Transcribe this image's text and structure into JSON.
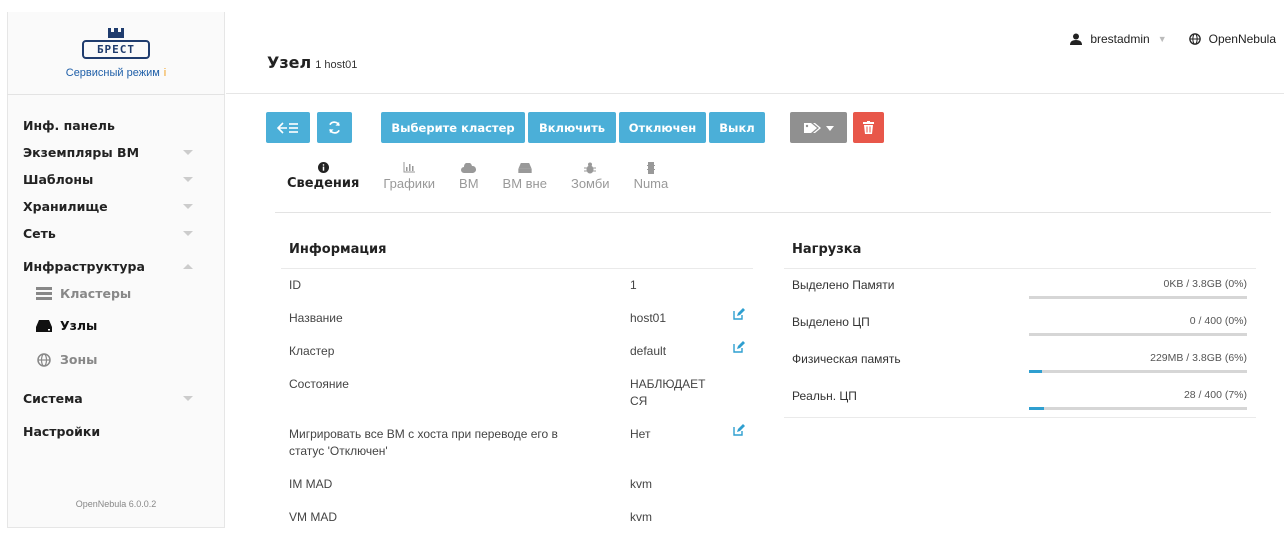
{
  "sidebar": {
    "logo_text": "БРЕСТ",
    "mode": "Сервисный режим",
    "mode_info": "i",
    "menu": [
      {
        "label": "Инф. панель"
      },
      {
        "label": "Экземпляры ВМ"
      },
      {
        "label": "Шаблоны"
      },
      {
        "label": "Хранилище"
      },
      {
        "label": "Сеть"
      },
      {
        "label": "Инфраструктура"
      },
      {
        "label": "Система"
      },
      {
        "label": "Настройки"
      }
    ],
    "submenu": [
      {
        "label": "Кластеры"
      },
      {
        "label": "Узлы"
      },
      {
        "label": "Зоны"
      }
    ],
    "version": "OpenNebula 6.0.0.2"
  },
  "header": {
    "title": "Узел",
    "subtitle": "1 host01",
    "user": "brestadmin",
    "zone": "OpenNebula"
  },
  "toolbar": {
    "choose_cluster": "Выберите кластер",
    "enable": "Включить",
    "disable": "Отключен",
    "off": "Выкл"
  },
  "tabs": [
    {
      "label": "Сведения"
    },
    {
      "label": "Графики"
    },
    {
      "label": "ВМ"
    },
    {
      "label": "ВМ вне"
    },
    {
      "label": "Зомби"
    },
    {
      "label": "Numa"
    }
  ],
  "info": {
    "title": "Информация",
    "rows": [
      {
        "key": "ID",
        "value": "1"
      },
      {
        "key": "Название",
        "value": "host01"
      },
      {
        "key": "Кластер",
        "value": "default"
      },
      {
        "key": "Состояние",
        "value": "НАБЛЮДАЕТСЯ"
      },
      {
        "key": "Мигрировать все ВМ с хоста при переводе его в статус 'Отключен'",
        "value": "Нет"
      },
      {
        "key": "IM MAD",
        "value": "kvm"
      },
      {
        "key": "VM MAD",
        "value": "kvm"
      }
    ]
  },
  "load": {
    "title": "Нагрузка",
    "rows": [
      {
        "key": "Выделено Памяти",
        "value": "0KB / 3.8GB (0%)",
        "percent": 0
      },
      {
        "key": "Выделено ЦП",
        "value": "0 / 400 (0%)",
        "percent": 0
      },
      {
        "key": "Физическая память",
        "value": "229MB / 3.8GB (6%)",
        "percent": 6
      },
      {
        "key": "Реальн. ЦП",
        "value": "28 / 400 (7%)",
        "percent": 7
      }
    ]
  },
  "colors": {
    "primary_button": "#4bafd8",
    "danger_button": "#e8574a",
    "progress_fill": "#2f9fd0"
  }
}
